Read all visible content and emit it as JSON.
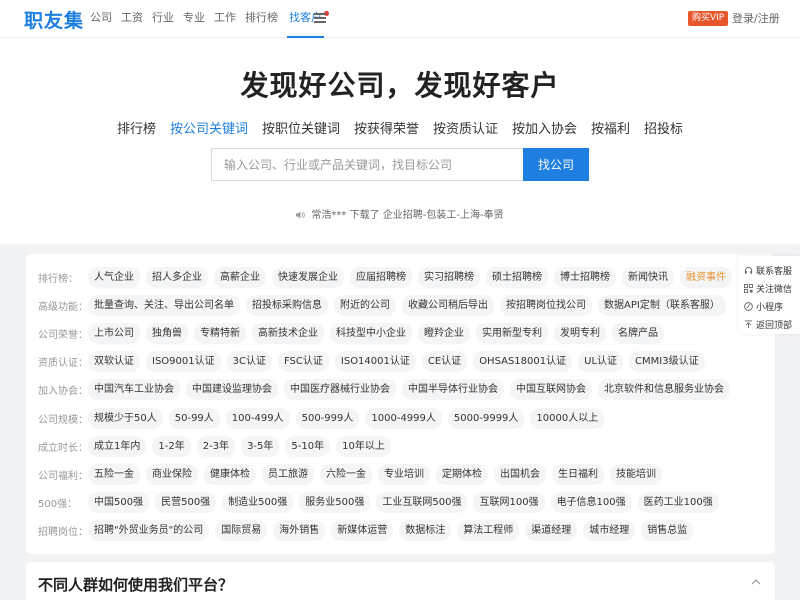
{
  "header": {
    "logo": "职友集",
    "nav": [
      "公司",
      "工资",
      "行业",
      "专业",
      "工作",
      "排行榜",
      "找客户"
    ],
    "vip": "购买VIP",
    "login": "登录/注册"
  },
  "hero": {
    "title": "发现好公司，发现好客户",
    "tabs": [
      "排行榜",
      "按公司关键词",
      "按职位关键词",
      "按获得荣誉",
      "按资质认证",
      "按加入协会",
      "按福利",
      "招投标"
    ],
    "active_tab": 1,
    "search_placeholder": "输入公司、行业或产品关键词，找目标公司",
    "search_button": "找公司",
    "ticker": "常浩*** 下载了 企业招聘-包装工-上海-奉贤"
  },
  "filters": [
    {
      "label": "排行榜：",
      "tags": [
        "人气企业",
        "招人多企业",
        "高薪企业",
        "快速发展企业",
        "应届招聘榜",
        "实习招聘榜",
        "硕士招聘榜",
        "博士招聘榜",
        "新闻快讯",
        "融资事件"
      ]
    },
    {
      "label": "高级功能：",
      "tags": [
        "批量查询、关注、导出公司名单",
        "招投标采购信息",
        "附近的公司",
        "收藏公司稍后导出",
        "按招聘岗位找公司",
        "数据API定制（联系客服）"
      ]
    },
    {
      "label": "公司荣誉：",
      "tags": [
        "上市公司",
        "独角兽",
        "专精特新",
        "高新技术企业",
        "科技型中小企业",
        "瞪羚企业",
        "实用新型专利",
        "发明专利",
        "名牌产品"
      ]
    },
    {
      "label": "资质认证：",
      "tags": [
        "双软认证",
        "ISO9001认证",
        "3C认证",
        "FSC认证",
        "ISO14001认证",
        "CE认证",
        "OHSAS18001认证",
        "UL认证",
        "CMMI3级认证"
      ]
    },
    {
      "label": "加入协会：",
      "tags": [
        "中国汽车工业协会",
        "中国建设监理协会",
        "中国医疗器械行业协会",
        "中国半导体行业协会",
        "中国互联网协会",
        "北京软件和信息服务业协会"
      ]
    },
    {
      "label": "公司规模：",
      "tags": [
        "规模少于50人",
        "50-99人",
        "100-499人",
        "500-999人",
        "1000-4999人",
        "5000-9999人",
        "10000人以上"
      ]
    },
    {
      "label": "成立时长：",
      "tags": [
        "成立1年内",
        "1-2年",
        "2-3年",
        "3-5年",
        "5-10年",
        "10年以上"
      ]
    },
    {
      "label": "公司福利：",
      "tags": [
        "五险一金",
        "商业保险",
        "健康体检",
        "员工旅游",
        "六险一金",
        "专业培训",
        "定期体检",
        "出国机会",
        "生日福利",
        "技能培训"
      ]
    },
    {
      "label": "500强：",
      "tags": [
        "中国500强",
        "民营500强",
        "制造业500强",
        "服务业500强",
        "工业互联网500强",
        "互联网100强",
        "电子信息100强",
        "医药工业100强"
      ]
    },
    {
      "label": "招聘岗位：",
      "tags": [
        "招聘\"外贸业务员\"的公司",
        "国际贸易",
        "海外销售",
        "新媒体运营",
        "数据标注",
        "算法工程师",
        "渠道经理",
        "城市经理",
        "销售总监"
      ]
    }
  ],
  "side": [
    "联系客服",
    "关注微信",
    "小程序",
    "返回顶部"
  ],
  "usage_title": "不同人群如何使用我们平台？",
  "colors": {
    "brand": "#1f7fe0",
    "vip": "#e8572c",
    "highlight": "#e8912c"
  }
}
